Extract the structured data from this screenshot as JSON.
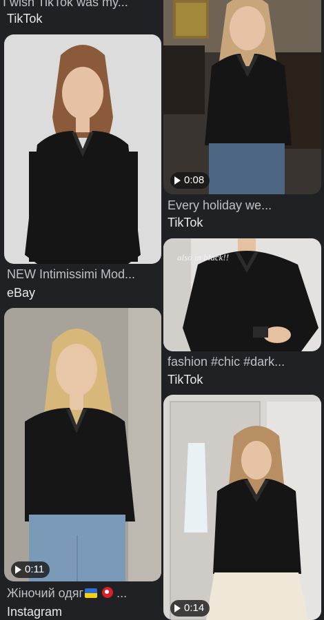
{
  "results": {
    "left": [
      {
        "title": "I wish TikTok was my...",
        "source": "TikTok"
      },
      {
        "title": "NEW Intimissimi Mod...",
        "source": "eBay"
      },
      {
        "title_prefix": "Жіночий одяг",
        "title_suffix": "...",
        "source": "Instagram",
        "duration": "0:11",
        "flags": [
          "ukraine-flag-icon",
          "turkey-flag-icon"
        ]
      }
    ],
    "right": [
      {
        "title": "Every holiday we...",
        "source": "TikTok",
        "duration": "0:08"
      },
      {
        "title": "fashion #chic #dark...",
        "source": "TikTok",
        "overlay": "also in black!!"
      },
      {
        "duration": "0:14"
      }
    ]
  },
  "colors": {
    "background": "#202124",
    "title_text": "#bdc1c6",
    "source_text": "#e8eaed",
    "badge_bg": "#141414"
  }
}
